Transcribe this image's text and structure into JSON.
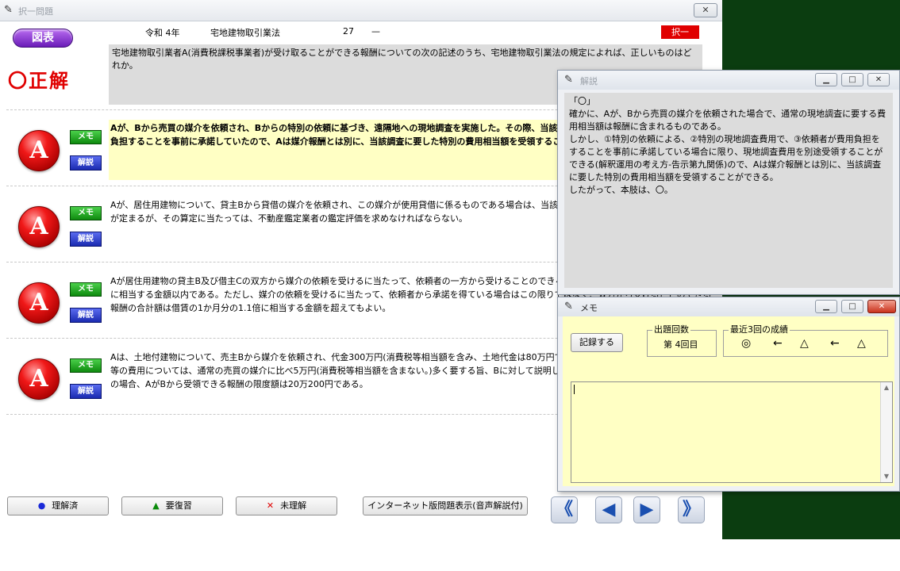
{
  "main_window": {
    "title": "択一問題",
    "close": "✕"
  },
  "header": {
    "zuhyo": "図表",
    "era": "令和 4年",
    "subject": "宅地建物取引業法",
    "number": "27",
    "dash": "—",
    "type_tag": "択一"
  },
  "result": "〇正解",
  "question": "宅地建物取引業者A(消費税課税事業者)が受け取ることができる報酬についての次の記述のうち、宅地建物取引業法の規定によれば、正しいものはどれか。",
  "choices": [
    {
      "badge": "A",
      "memo": "メモ",
      "kaisetsu": "解説",
      "text": "Aが、Bから売買の媒介を依頼され、Bからの特別の依頼に基づき、遠隔地への現地調査を実施した。その際、当該調査に要する特別の費用について、Bが負担することを事前に承諾していたので、Aは媒介報酬とは別に、当該調査に要した特別の費用相当額を受領することができる。"
    },
    {
      "badge": "A",
      "memo": "メモ",
      "kaisetsu": "解説",
      "text": "Aが、居住用建物について、貸主Bから貸借の媒介を依頼され、この媒介が使用貸借に係るものである場合は、当該建物の通常の借賃をもとに報酬の限度額が定まるが、その算定に当たっては、不動産鑑定業者の鑑定評価を求めなければならない。"
    },
    {
      "badge": "A",
      "memo": "メモ",
      "kaisetsu": "解説",
      "text": "Aが居住用建物の貸主B及び借主Cの双方から媒介の依頼を受けるに当たって、依頼者の一方から受けることのできる報酬の額は、借賃の1か月分の0.55倍に相当する金額以内である。ただし、媒介の依頼を受けるに当たって、依頼者から承諾を得ている場合はこの限りではなく、双方から受けることのできる報酬の合計額は借賃の1か月分の1.1倍に相当する金額を超えてもよい。"
    },
    {
      "badge": "A",
      "memo": "メモ",
      "kaisetsu": "解説",
      "text": "Aは、土地付建物について、売主Bから媒介を依頼され、代金300万円(消費税等相当額を含み、土地代金は80万円である。)で契約を成立させた。現地調査等の費用については、通常の売買の媒介に比べ5万円(消費税等相当額を含まない。)多く要する旨、Bに対して説明し、合意の上、媒介契約を締結した。この場合、AがBから受領できる報酬の限度額は20万200円である。"
    }
  ],
  "bottom_buttons": {
    "understood": "理解済",
    "review": "要復習",
    "not_understood": "未理解",
    "internet": "インターネット版問題表示(音声解説付)"
  },
  "nav": {
    "first": "《",
    "prev": "◀",
    "next": "▶",
    "last": "》"
  },
  "kaisetsu_window": {
    "title": "解説",
    "lines": [
      "「〇」",
      "確かに、Aが、Bから売買の媒介を依頼された場合で、通常の現地調査に要する費用相当額は報酬に含まれるものである。",
      "しかし、①特別の依頼による、②特別の現地調査費用で、③依頼者が費用負担をすることを事前に承諾している場合に限り、現地調査費用を別途受領することができる(解釈運用の考え方-告示第九関係)ので、Aは媒介報酬とは別に、当該調査に要した特別の費用相当額を受領することができる。",
      "したがって、本肢は、〇。"
    ]
  },
  "memo_window": {
    "title": "メモ",
    "record_button": "記録する",
    "count_label": "出題回数",
    "count_value": "第 4回目",
    "recent_label": "最近3回の成績",
    "recent_marks": [
      "◎",
      "←",
      "△",
      "←",
      "△"
    ],
    "memo_text": ""
  },
  "colors": {
    "accent_red": "#e00000",
    "memo_bg": "#ffffc4",
    "desktop_green": "#0b3d10"
  },
  "icons": {
    "app": "app-icon",
    "close": "close-icon"
  }
}
